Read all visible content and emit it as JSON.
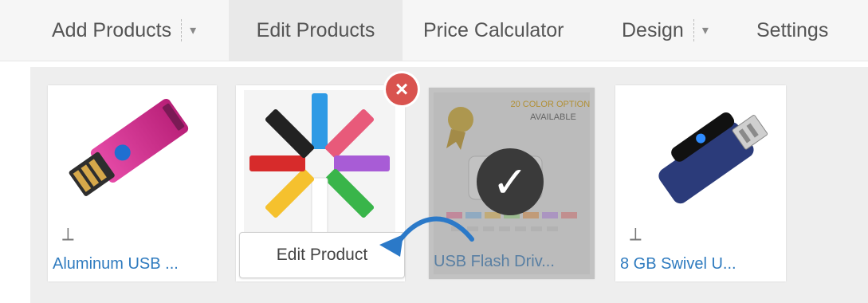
{
  "nav": {
    "items": [
      {
        "label": "Add Products",
        "has_dropdown": true,
        "active": false
      },
      {
        "label": "Edit Products",
        "has_dropdown": false,
        "active": true
      },
      {
        "label": "Price Calculator",
        "has_dropdown": false,
        "active": false
      },
      {
        "label": "Design",
        "has_dropdown": true,
        "active": false
      },
      {
        "label": "Settings",
        "has_dropdown": false,
        "active": false
      }
    ],
    "caret": "▾"
  },
  "products": [
    {
      "title": "Aluminum USB ...",
      "vendor_icon": "vendor-icon"
    },
    {
      "title": "",
      "vendor_icon": "",
      "hovered": true
    },
    {
      "title": "USB Flash Driv...",
      "vendor_icon": "",
      "selected": true
    },
    {
      "title": "8 GB Swivel U...",
      "vendor_icon": "vendor-icon"
    }
  ],
  "controls": {
    "edit_product_label": "Edit Product",
    "close_symbol": "×",
    "check_symbol": "✓"
  },
  "badge": {
    "line1": "20 COLOR OPTIONS",
    "line2": "AVAILABLE"
  },
  "colors": {
    "link": "#2f7bbf",
    "close_red": "#d9534f",
    "overlay_dark": "#3a3a3a"
  }
}
